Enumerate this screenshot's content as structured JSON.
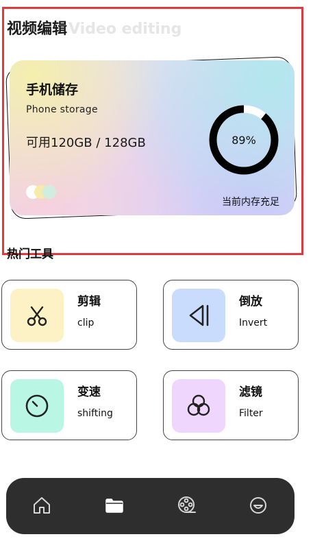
{
  "header": {
    "title_cn": "视频编辑",
    "title_en": "Video editing"
  },
  "storage": {
    "title": "手机储存",
    "subtitle": "Phone  storage",
    "capacity": "可用120GB / 128GB",
    "percent_label": "89%",
    "percent_value": 0.89,
    "status": "当前内存充足",
    "dot_colors": [
      "#fdfdfd",
      "#f6eba8",
      "#cfeedd"
    ]
  },
  "tools": {
    "section_title": "热门工具",
    "items": [
      {
        "label": "剪辑",
        "sub": "clip",
        "icon": "scissors-icon",
        "color": "#fdf2c6"
      },
      {
        "label": "倒放",
        "sub": "Invert",
        "icon": "rewind-icon",
        "color": "#c9dcfd"
      },
      {
        "label": "变速",
        "sub": "shifting",
        "icon": "speed-gauge-icon",
        "color": "#b9f6e3"
      },
      {
        "label": "滤镜",
        "sub": "Filter",
        "icon": "filter-icon",
        "color": "#eed6fc"
      }
    ]
  },
  "nav": {
    "items": [
      "home-icon",
      "folder-icon",
      "film-reel-icon",
      "profile-icon"
    ],
    "active": "folder-icon"
  }
}
